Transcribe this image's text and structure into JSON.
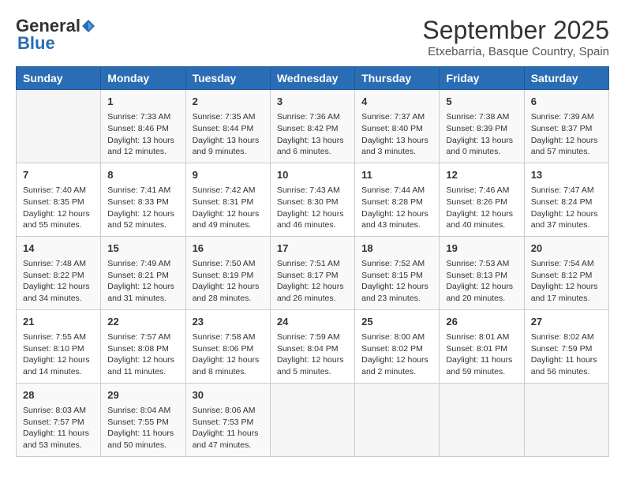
{
  "logo": {
    "general": "General",
    "blue": "Blue"
  },
  "title": {
    "month_year": "September 2025",
    "location": "Etxebarria, Basque Country, Spain"
  },
  "headers": [
    "Sunday",
    "Monday",
    "Tuesday",
    "Wednesday",
    "Thursday",
    "Friday",
    "Saturday"
  ],
  "weeks": [
    [
      {
        "day": "",
        "content": ""
      },
      {
        "day": "1",
        "content": "Sunrise: 7:33 AM\nSunset: 8:46 PM\nDaylight: 13 hours\nand 12 minutes."
      },
      {
        "day": "2",
        "content": "Sunrise: 7:35 AM\nSunset: 8:44 PM\nDaylight: 13 hours\nand 9 minutes."
      },
      {
        "day": "3",
        "content": "Sunrise: 7:36 AM\nSunset: 8:42 PM\nDaylight: 13 hours\nand 6 minutes."
      },
      {
        "day": "4",
        "content": "Sunrise: 7:37 AM\nSunset: 8:40 PM\nDaylight: 13 hours\nand 3 minutes."
      },
      {
        "day": "5",
        "content": "Sunrise: 7:38 AM\nSunset: 8:39 PM\nDaylight: 13 hours\nand 0 minutes."
      },
      {
        "day": "6",
        "content": "Sunrise: 7:39 AM\nSunset: 8:37 PM\nDaylight: 12 hours\nand 57 minutes."
      }
    ],
    [
      {
        "day": "7",
        "content": "Sunrise: 7:40 AM\nSunset: 8:35 PM\nDaylight: 12 hours\nand 55 minutes."
      },
      {
        "day": "8",
        "content": "Sunrise: 7:41 AM\nSunset: 8:33 PM\nDaylight: 12 hours\nand 52 minutes."
      },
      {
        "day": "9",
        "content": "Sunrise: 7:42 AM\nSunset: 8:31 PM\nDaylight: 12 hours\nand 49 minutes."
      },
      {
        "day": "10",
        "content": "Sunrise: 7:43 AM\nSunset: 8:30 PM\nDaylight: 12 hours\nand 46 minutes."
      },
      {
        "day": "11",
        "content": "Sunrise: 7:44 AM\nSunset: 8:28 PM\nDaylight: 12 hours\nand 43 minutes."
      },
      {
        "day": "12",
        "content": "Sunrise: 7:46 AM\nSunset: 8:26 PM\nDaylight: 12 hours\nand 40 minutes."
      },
      {
        "day": "13",
        "content": "Sunrise: 7:47 AM\nSunset: 8:24 PM\nDaylight: 12 hours\nand 37 minutes."
      }
    ],
    [
      {
        "day": "14",
        "content": "Sunrise: 7:48 AM\nSunset: 8:22 PM\nDaylight: 12 hours\nand 34 minutes."
      },
      {
        "day": "15",
        "content": "Sunrise: 7:49 AM\nSunset: 8:21 PM\nDaylight: 12 hours\nand 31 minutes."
      },
      {
        "day": "16",
        "content": "Sunrise: 7:50 AM\nSunset: 8:19 PM\nDaylight: 12 hours\nand 28 minutes."
      },
      {
        "day": "17",
        "content": "Sunrise: 7:51 AM\nSunset: 8:17 PM\nDaylight: 12 hours\nand 26 minutes."
      },
      {
        "day": "18",
        "content": "Sunrise: 7:52 AM\nSunset: 8:15 PM\nDaylight: 12 hours\nand 23 minutes."
      },
      {
        "day": "19",
        "content": "Sunrise: 7:53 AM\nSunset: 8:13 PM\nDaylight: 12 hours\nand 20 minutes."
      },
      {
        "day": "20",
        "content": "Sunrise: 7:54 AM\nSunset: 8:12 PM\nDaylight: 12 hours\nand 17 minutes."
      }
    ],
    [
      {
        "day": "21",
        "content": "Sunrise: 7:55 AM\nSunset: 8:10 PM\nDaylight: 12 hours\nand 14 minutes."
      },
      {
        "day": "22",
        "content": "Sunrise: 7:57 AM\nSunset: 8:08 PM\nDaylight: 12 hours\nand 11 minutes."
      },
      {
        "day": "23",
        "content": "Sunrise: 7:58 AM\nSunset: 8:06 PM\nDaylight: 12 hours\nand 8 minutes."
      },
      {
        "day": "24",
        "content": "Sunrise: 7:59 AM\nSunset: 8:04 PM\nDaylight: 12 hours\nand 5 minutes."
      },
      {
        "day": "25",
        "content": "Sunrise: 8:00 AM\nSunset: 8:02 PM\nDaylight: 12 hours\nand 2 minutes."
      },
      {
        "day": "26",
        "content": "Sunrise: 8:01 AM\nSunset: 8:01 PM\nDaylight: 11 hours\nand 59 minutes."
      },
      {
        "day": "27",
        "content": "Sunrise: 8:02 AM\nSunset: 7:59 PM\nDaylight: 11 hours\nand 56 minutes."
      }
    ],
    [
      {
        "day": "28",
        "content": "Sunrise: 8:03 AM\nSunset: 7:57 PM\nDaylight: 11 hours\nand 53 minutes."
      },
      {
        "day": "29",
        "content": "Sunrise: 8:04 AM\nSunset: 7:55 PM\nDaylight: 11 hours\nand 50 minutes."
      },
      {
        "day": "30",
        "content": "Sunrise: 8:06 AM\nSunset: 7:53 PM\nDaylight: 11 hours\nand 47 minutes."
      },
      {
        "day": "",
        "content": ""
      },
      {
        "day": "",
        "content": ""
      },
      {
        "day": "",
        "content": ""
      },
      {
        "day": "",
        "content": ""
      }
    ]
  ]
}
